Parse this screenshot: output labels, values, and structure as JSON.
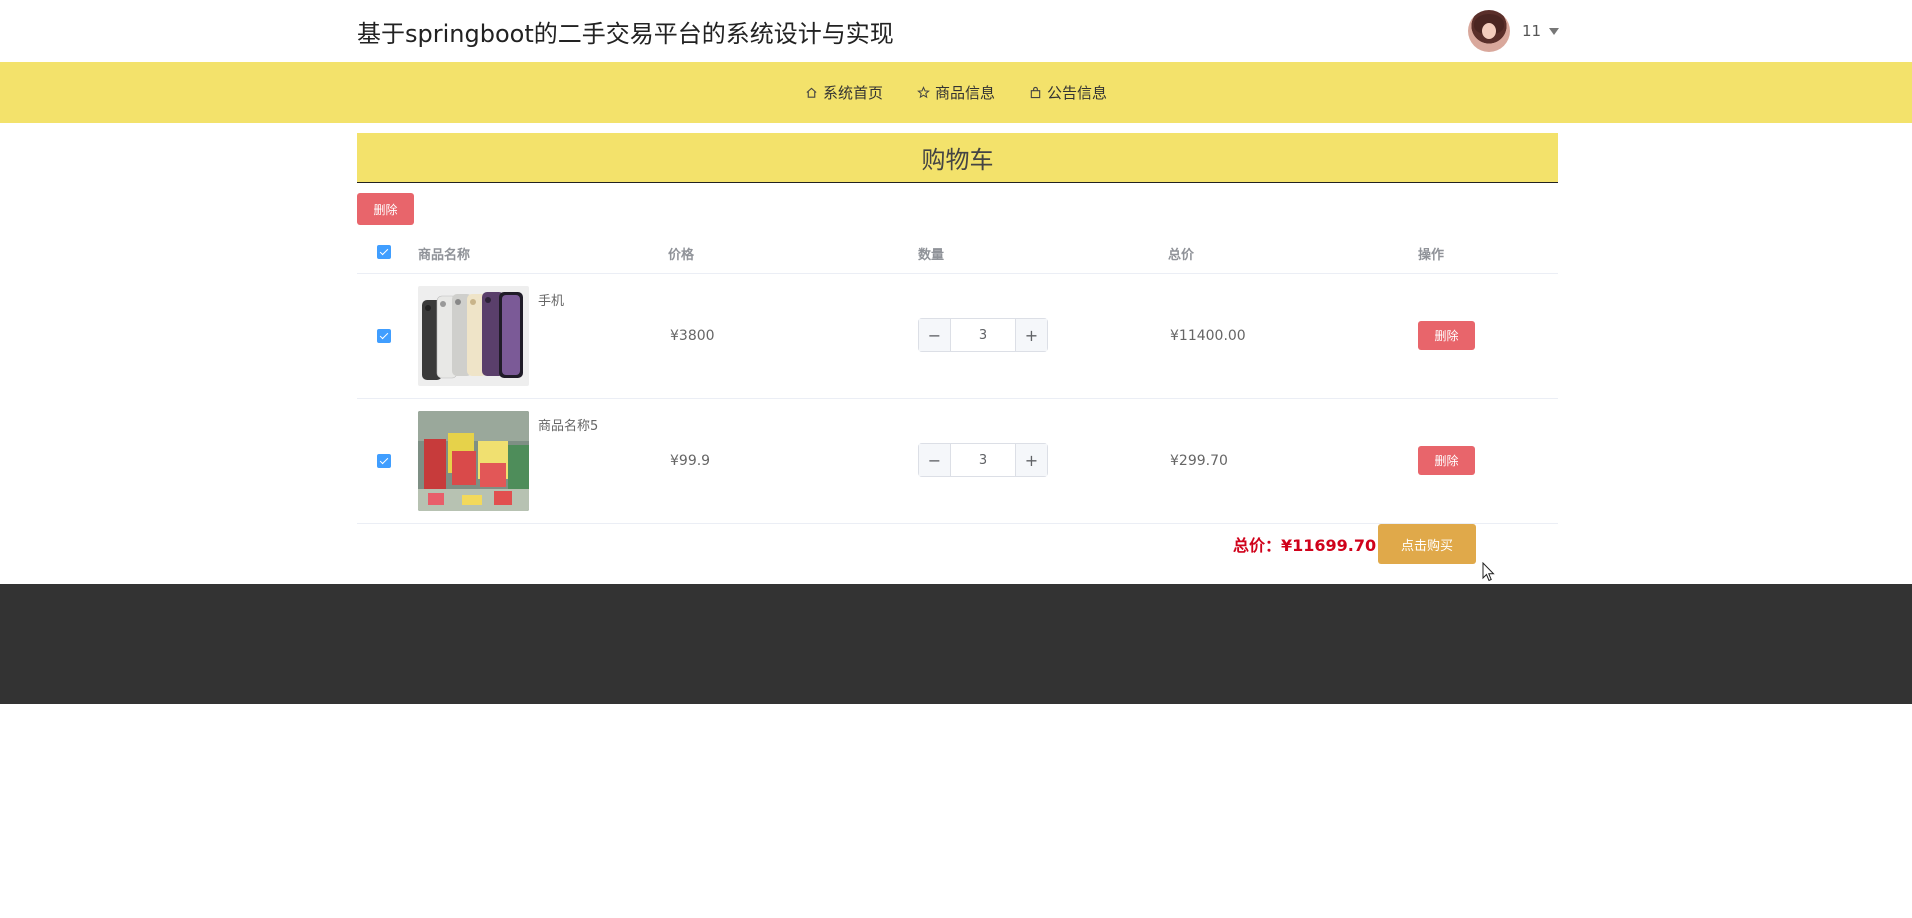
{
  "header": {
    "site_title": "基于springboot的二手交易平台的系统设计与实现",
    "username": "11"
  },
  "nav": {
    "items": [
      {
        "label": "系统首页",
        "icon": "home-icon"
      },
      {
        "label": "商品信息",
        "icon": "star-icon"
      },
      {
        "label": "公告信息",
        "icon": "bag-icon"
      }
    ]
  },
  "cart": {
    "title": "购物车",
    "delete_selected_label": "删除",
    "columns": [
      "商品名称",
      "价格",
      "数量",
      "总价",
      "操作"
    ],
    "rows": [
      {
        "name": "手机",
        "price": "¥3800",
        "quantity": "3",
        "total": "¥11400.00",
        "action_label": "删除",
        "checked": true
      },
      {
        "name": "商品名称5",
        "price": "¥99.9",
        "quantity": "3",
        "total": "¥299.70",
        "action_label": "删除",
        "checked": true
      }
    ],
    "summary": "总价：¥11699.70",
    "buy_label": "点击购买"
  },
  "colors": {
    "nav_bg": "#f3e26b",
    "delete_btn": "#e8656b",
    "buy_btn": "#e0a94a",
    "total_text": "#d0021b",
    "footer_bg": "#333333",
    "checkbox": "#409eff"
  }
}
